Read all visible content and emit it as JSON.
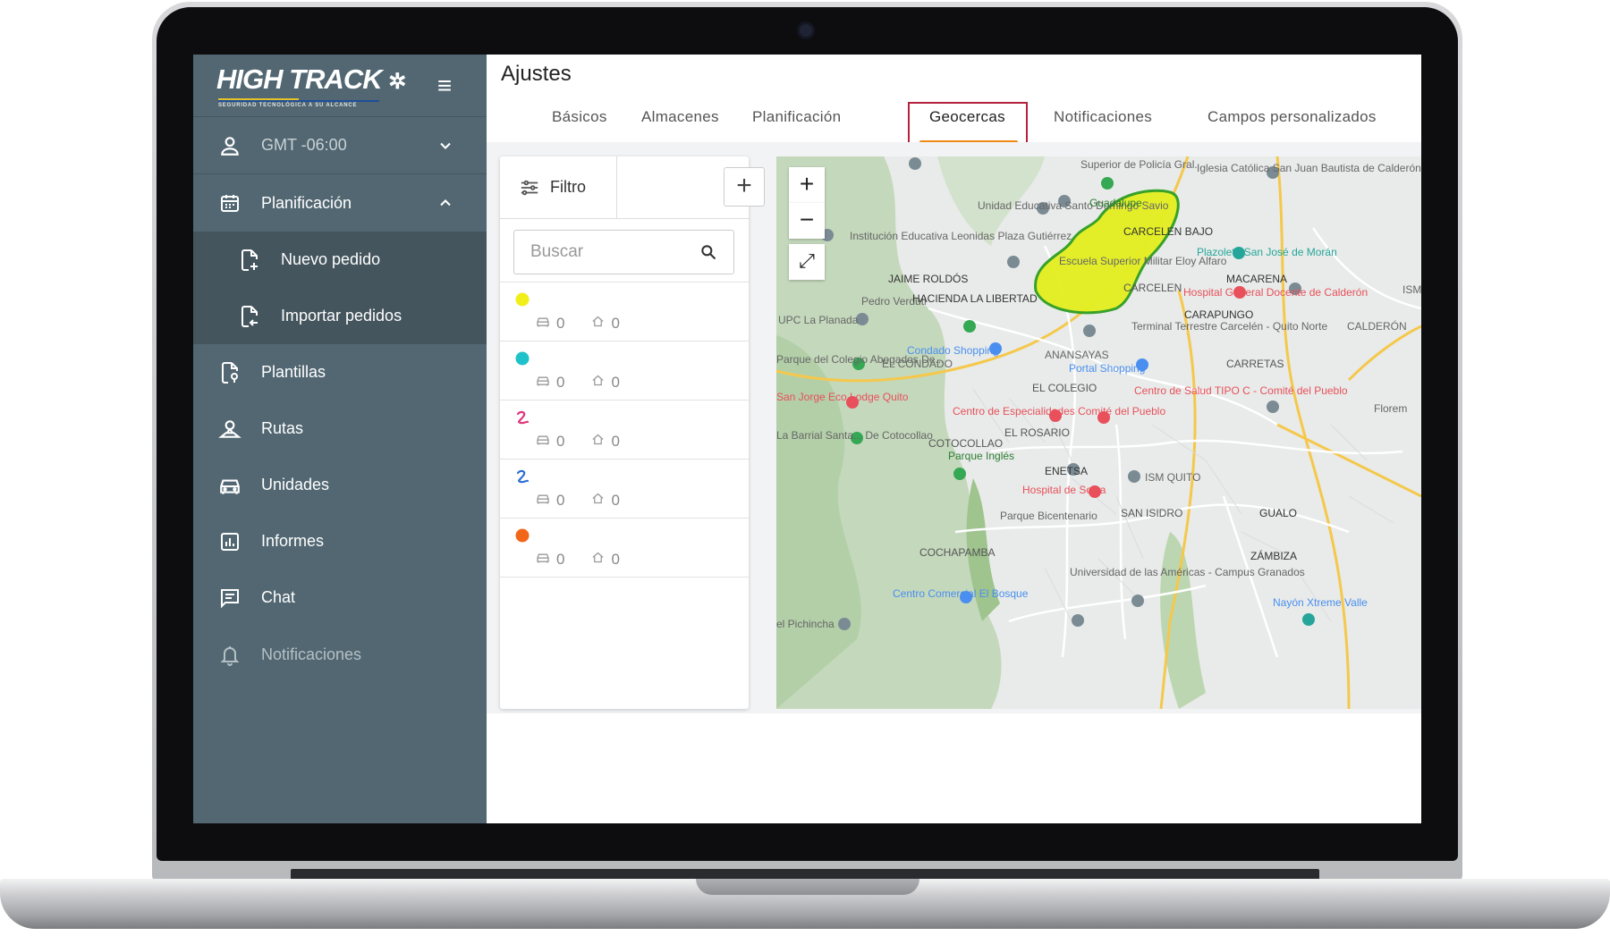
{
  "app": {
    "brand": "HIGH TRACK",
    "brand_tagline": "SEGURIDAD TECNOLÓGICA A SU ALCANCE",
    "colors": {
      "sidebar": "#526772",
      "sidebar_active": "#44555e",
      "accent": "#f08a17",
      "highlight_border": "#b5223c",
      "geofence_fill": "#e3ef1f",
      "geofence_stroke": "#2e9e1f"
    }
  },
  "sidebar": {
    "timezone": "GMT -06:00",
    "items": [
      {
        "label": "Planificación",
        "icon": "calendar-icon",
        "expanded": true
      },
      {
        "label": "Nuevo pedido",
        "icon": "file-add-icon"
      },
      {
        "label": "Importar pedidos",
        "icon": "file-import-icon"
      },
      {
        "label": "Plantillas",
        "icon": "template-icon"
      },
      {
        "label": "Rutas",
        "icon": "route-icon"
      },
      {
        "label": "Unidades",
        "icon": "car-icon"
      },
      {
        "label": "Informes",
        "icon": "chart-icon"
      },
      {
        "label": "Chat",
        "icon": "chat-icon"
      },
      {
        "label": "Notificaciones",
        "icon": "bell-icon"
      }
    ]
  },
  "page": {
    "title": "Ajustes",
    "tabs": [
      {
        "label": "Básicos"
      },
      {
        "label": "Almacenes"
      },
      {
        "label": "Planificación"
      },
      {
        "label": "Geocercas",
        "active": true
      },
      {
        "label": "Notificaciones"
      },
      {
        "label": "Campos personalizados"
      }
    ]
  },
  "geofences": {
    "filter_label": "Filtro",
    "search_placeholder": "Buscar",
    "items": [
      {
        "marker": "dot",
        "color": "#f2ee19",
        "vehicles": "0",
        "warehouses": "0"
      },
      {
        "marker": "dot",
        "color": "#1fc2c8",
        "vehicles": "0",
        "warehouses": "0"
      },
      {
        "marker": "squiggle",
        "color": "#e0347a",
        "vehicles": "0",
        "warehouses": "0"
      },
      {
        "marker": "squiggle",
        "color": "#2d6fd1",
        "vehicles": "0",
        "warehouses": "0"
      },
      {
        "marker": "dot",
        "color": "#f2661a",
        "vehicles": "0",
        "warehouses": "0"
      }
    ]
  },
  "map": {
    "zoom_in": "+",
    "zoom_out": "−",
    "labels": [
      "Superior de Policía Gral.",
      "Iglesia Católica San Juan Bautista de Calderón",
      "Unidad Educativa Santo Domingo Savio",
      "Guadalupe",
      "CARCELEN BAJO",
      "Institución Educativa Leonidas Plaza Gutiérrez",
      "Escuela Superior Militar Eloy Alfaro",
      "CARCELEN",
      "Plazoleta San José de Morán",
      "JAIME ROLDÓS",
      "MACARENA",
      "Hospital General Docente de Calderón",
      "Pedro Verduti",
      "HACIENDA LA LIBERTAD",
      "CARAPUNGO",
      "UPC La Planada",
      "Terminal Terrestre Carcelén - Quito Norte",
      "Condado Shopping",
      "EL CONDADO",
      "ANANSAYAS",
      "Parque del Colegio Abogados De...",
      "Portal Shopping",
      "CARRETAS",
      "San Jorge Eco Lodge Quito",
      "EL COLEGIO",
      "Centro de Salud TIPO C - Comité del Pueblo",
      "Centro de Especialidades Comité del Pueblo",
      "EL ROSARIO",
      "Florem",
      "La Barrial Santa... De Cotocollao",
      "COTOCOLLAO",
      "Parque Inglés",
      "ENETSA",
      "ISM QUITO",
      "Hospital de Solca",
      "SAN ISIDRO",
      "GUALO",
      "Parque Bicentenario",
      "COCHAPAMBA",
      "ZÁMBIZA",
      "Universidad de las Américas - Campus Granados",
      "Centro Comercial El Bosque",
      "Nayón Xtreme Valle",
      "el Pichincha",
      "CALDERÓN",
      "ISM"
    ]
  }
}
